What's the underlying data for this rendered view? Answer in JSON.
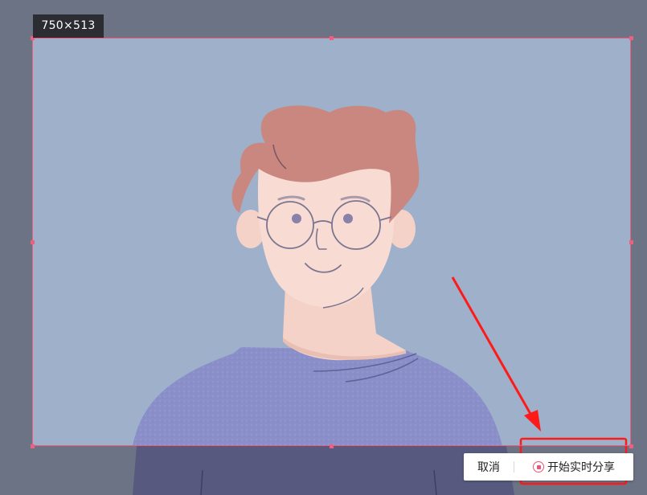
{
  "capture": {
    "size_label": "750×513"
  },
  "toolbar": {
    "cancel_label": "取消",
    "share_label": "开始实时分享",
    "share_icon": "record-icon"
  },
  "colors": {
    "selection_border": "#ef5f7f",
    "backdrop": "#6b7384",
    "preview_bg": "#9fb0cb",
    "annotation_red": "#ff1a1a",
    "accent": "#e8567a"
  }
}
